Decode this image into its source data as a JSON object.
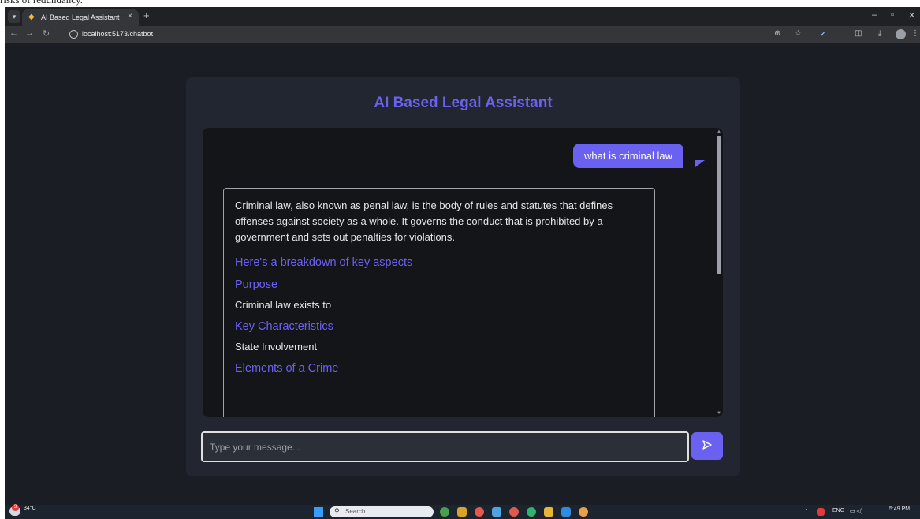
{
  "overlay_text": "risks of redundancy.",
  "browser": {
    "tab_title": "AI Based Legal Assistant",
    "tab_close": "×",
    "new_tab": "+",
    "url": "localhost:5173/chatbot",
    "nav": {
      "back": "←",
      "forward": "→",
      "reload": "↻"
    },
    "window_controls": {
      "minimize": "–",
      "maximize": "▫",
      "close": "✕"
    }
  },
  "app": {
    "title": "AI Based Legal Assistant",
    "messages": [
      {
        "role": "user",
        "text": "what is criminal law"
      }
    ],
    "bot_response": {
      "intro": "Criminal law, also known as penal law, is the body of rules and statutes that defines offenses against society as a whole. It governs the conduct that is prohibited by a government and sets out penalties for violations.",
      "heading_breakdown": "Here's a breakdown of key aspects",
      "heading_purpose": "Purpose",
      "purpose_text": "Criminal law exists to",
      "heading_characteristics": "Key Characteristics",
      "characteristics_text": "State Involvement",
      "heading_elements": "Elements of a Crime"
    },
    "input": {
      "placeholder": "Type your message...",
      "value": ""
    },
    "send_icon": "send-icon"
  },
  "taskbar": {
    "weather_temp": "34°C",
    "weather_badge": "3",
    "search_placeholder": "Search",
    "tray_language": "ENG",
    "time": "5:49 PM"
  },
  "colors": {
    "accent": "#6b61f0",
    "page_bg": "#1a1d23",
    "card_bg": "#222630",
    "chat_bg": "#131519"
  }
}
